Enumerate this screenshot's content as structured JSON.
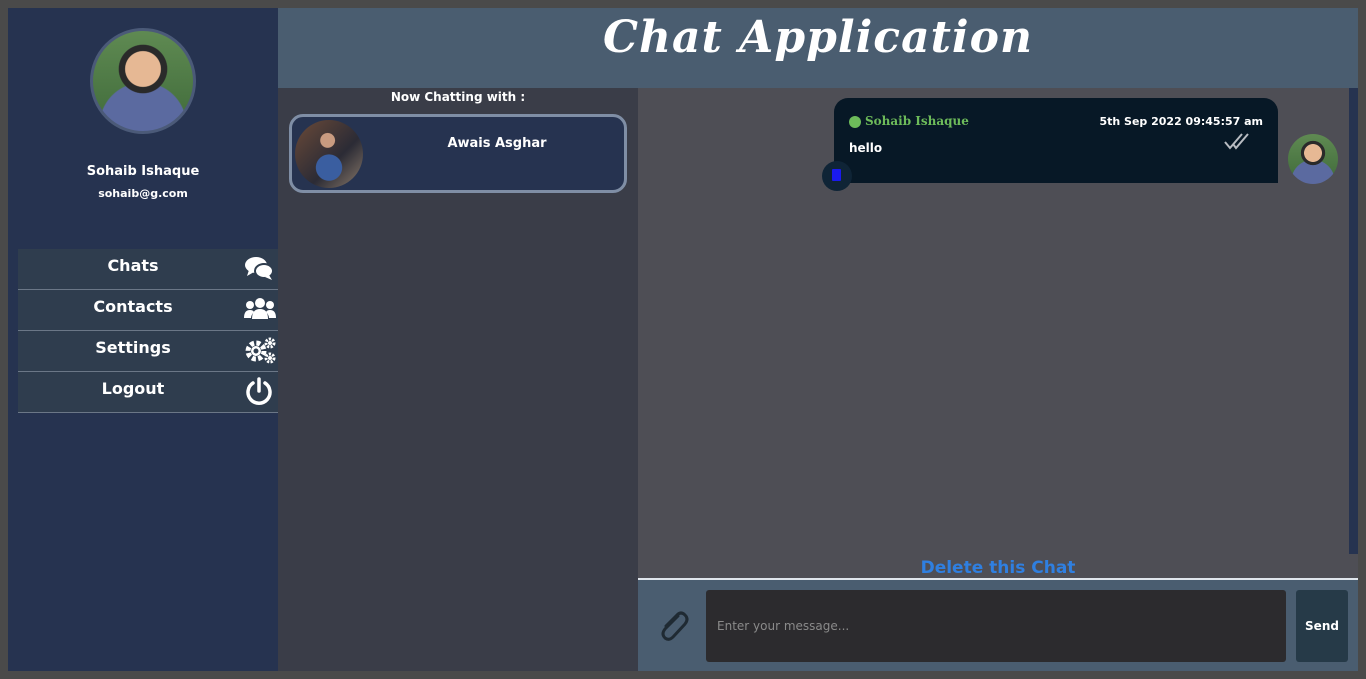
{
  "header": {
    "title": "Chat Application"
  },
  "profile": {
    "name": "Sohaib Ishaque",
    "email": "sohaib@g.com"
  },
  "nav": {
    "items": [
      {
        "label": "Chats",
        "icon": "chat-bubbles-icon"
      },
      {
        "label": "Contacts",
        "icon": "users-icon"
      },
      {
        "label": "Settings",
        "icon": "gears-icon"
      },
      {
        "label": "Logout",
        "icon": "power-icon"
      }
    ]
  },
  "contacts": {
    "heading": "Now Chatting with :",
    "active": {
      "name": "Awais Asghar"
    }
  },
  "chat": {
    "messages": [
      {
        "sender": "Sohaib Ishaque",
        "time": "5th Sep 2022 09:45:57 am",
        "text": "hello",
        "status": "double-check-icon"
      }
    ],
    "delete_label": "Delete this Chat"
  },
  "composer": {
    "placeholder": "Enter your message...",
    "send_label": "Send"
  },
  "colors": {
    "sidebar": "#263350",
    "header": "#4a5d70",
    "online": "#6dbb5a",
    "link": "#2f7fe0"
  }
}
